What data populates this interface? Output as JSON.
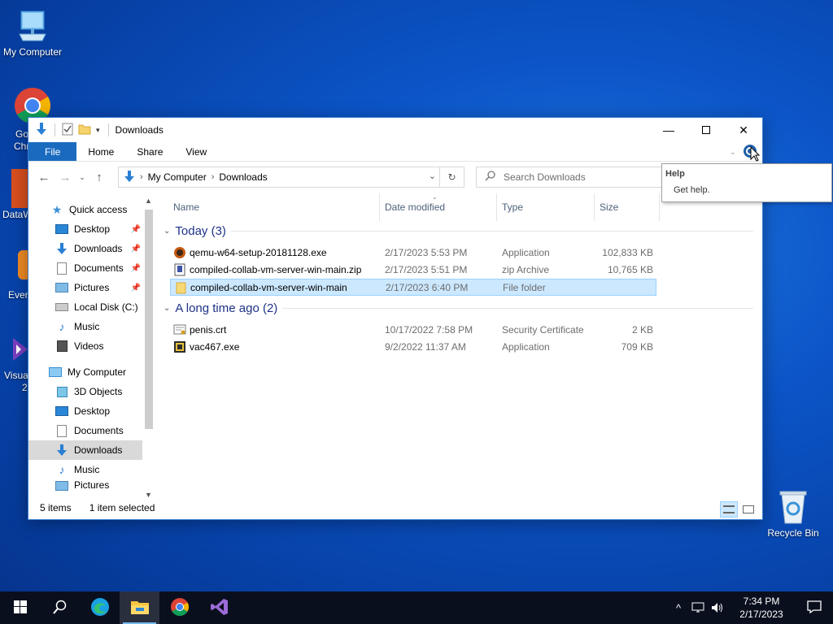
{
  "desktop": {
    "my_computer_label": "My Computer",
    "chrome_partial": "Go",
    "chrome_partial2": "Chr",
    "dataw_partial": "DataW",
    "ever_partial": "Ever",
    "visual_partial": "Visua",
    "visual_partial2": "2",
    "recycle_label": "Recycle Bin"
  },
  "window": {
    "title": "Downloads",
    "ribbon_tabs": [
      "File",
      "Home",
      "Share",
      "View"
    ]
  },
  "address": {
    "crumbs": [
      "My Computer",
      "Downloads"
    ],
    "search_placeholder": "Search Downloads"
  },
  "columns": {
    "name": "Name",
    "date": "Date modified",
    "type": "Type",
    "size": "Size"
  },
  "nav": {
    "quick_access": "Quick access",
    "qa_items": [
      "Desktop",
      "Downloads",
      "Documents",
      "Pictures",
      "Local Disk (C:)",
      "Music",
      "Videos"
    ],
    "my_computer": "My Computer",
    "mc_items": [
      "3D Objects",
      "Desktop",
      "Documents",
      "Downloads",
      "Music",
      "Pictures"
    ]
  },
  "groups": {
    "today": "Today (3)",
    "long_ago": "A long time ago (2)"
  },
  "files": [
    {
      "name": "qemu-w64-setup-20181128.exe",
      "date": "2/17/2023 5:53 PM",
      "type": "Application",
      "size": "102,833 KB"
    },
    {
      "name": "compiled-collab-vm-server-win-main.zip",
      "date": "2/17/2023 5:51 PM",
      "type": "zip Archive",
      "size": "10,765 KB"
    },
    {
      "name": "compiled-collab-vm-server-win-main",
      "date": "2/17/2023 6:40 PM",
      "type": "File folder",
      "size": ""
    },
    {
      "name": "penis.crt",
      "date": "10/17/2022 7:58 PM",
      "type": "Security Certificate",
      "size": "2 KB"
    },
    {
      "name": "vac467.exe",
      "date": "9/2/2022 11:37 AM",
      "type": "Application",
      "size": "709 KB"
    }
  ],
  "status": {
    "count": "5 items",
    "selected": "1 item selected"
  },
  "tooltip": {
    "title": "Help",
    "text": "Get help."
  },
  "clock": {
    "time": "7:34 PM",
    "date": "2/17/2023"
  },
  "colors": {
    "accent": "#1a6bc0",
    "selection": "#cce8ff",
    "group_header": "#1e3287"
  }
}
